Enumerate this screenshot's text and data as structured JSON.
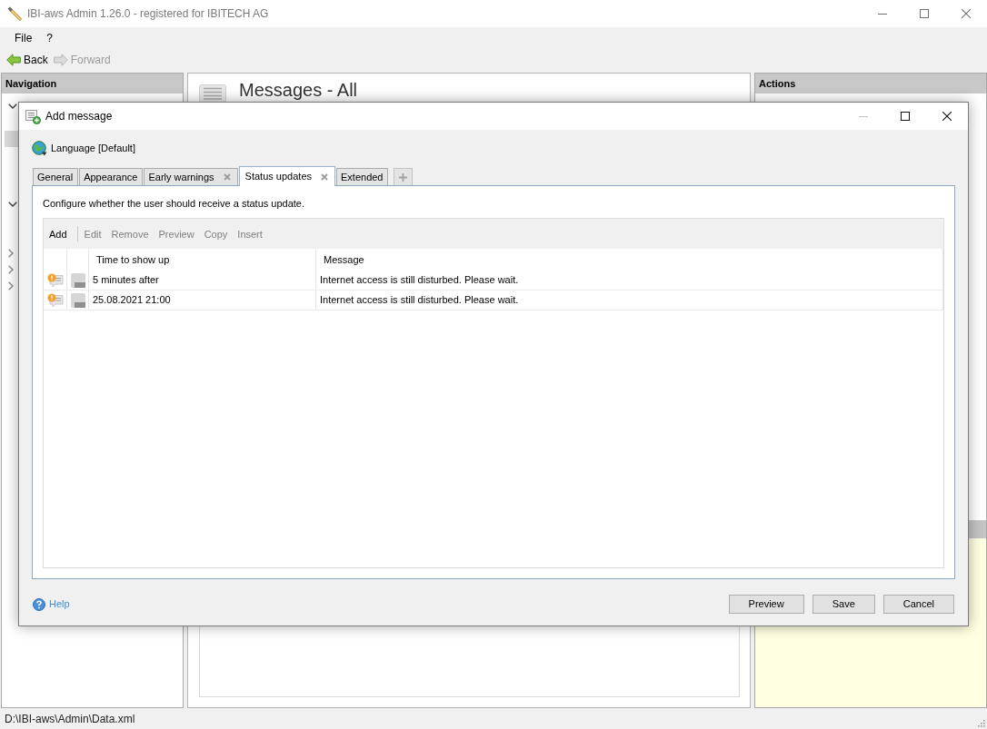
{
  "app_window": {
    "title": "IBI-aws Admin 1.26.0 - registered for IBITECH AG"
  },
  "menu": [
    "File",
    "?"
  ],
  "toolbar": [
    {
      "kind": "back",
      "label": "Back",
      "disabled": false
    },
    {
      "kind": "forward",
      "label": "Forward",
      "disabled": true
    }
  ],
  "navigation": {
    "title": "Navigation",
    "items": [
      {
        "expanded": true,
        "selected": false,
        "children": [
          {
            "selected": false
          },
          {
            "selected": true
          },
          {
            "selected": false
          },
          {
            "selected": false
          },
          {
            "selected": false
          }
        ]
      },
      {
        "expanded": true,
        "selected": false,
        "children": [
          {
            "selected": false
          },
          {
            "selected": false
          }
        ]
      },
      {
        "expanded": false,
        "selected": false
      },
      {
        "expanded": false,
        "selected": false
      },
      {
        "expanded": false,
        "selected": false
      }
    ]
  },
  "content": {
    "title": "Messages - All"
  },
  "actions": {
    "title": "Actions"
  },
  "dialog": {
    "title": "Add message",
    "language": "Language [Default]",
    "tabs": [
      {
        "label": "General",
        "selected": false,
        "closable": false
      },
      {
        "label": "Appearance",
        "selected": false,
        "closable": false
      },
      {
        "label": "Early warnings",
        "selected": false,
        "closable": true
      },
      {
        "label": "Status updates",
        "selected": true,
        "closable": true
      },
      {
        "label": "Extended",
        "selected": false,
        "closable": false
      }
    ],
    "description": "Configure whether the user should receive a status update.",
    "grid_toolbar": [
      {
        "label": "Add",
        "disabled": false,
        "separator_after": true
      },
      {
        "label": "Edit",
        "disabled": true
      },
      {
        "label": "Remove",
        "disabled": true
      },
      {
        "label": "Preview",
        "disabled": true
      },
      {
        "label": "Copy",
        "disabled": true
      },
      {
        "label": "Insert",
        "disabled": true
      }
    ],
    "columns": [
      "Time to show up",
      "Message"
    ],
    "rows": [
      {
        "time": "5 minutes after",
        "message": "Internet access is still disturbed. Please wait."
      },
      {
        "time": "25.08.2021 21:00",
        "message": "Internet access is still disturbed. Please wait."
      }
    ],
    "help": "Help",
    "buttons": [
      "Preview",
      "Save",
      "Cancel"
    ]
  },
  "status_bar": {
    "path": "D:\\IBI-aws\\Admin\\Data.xml"
  }
}
